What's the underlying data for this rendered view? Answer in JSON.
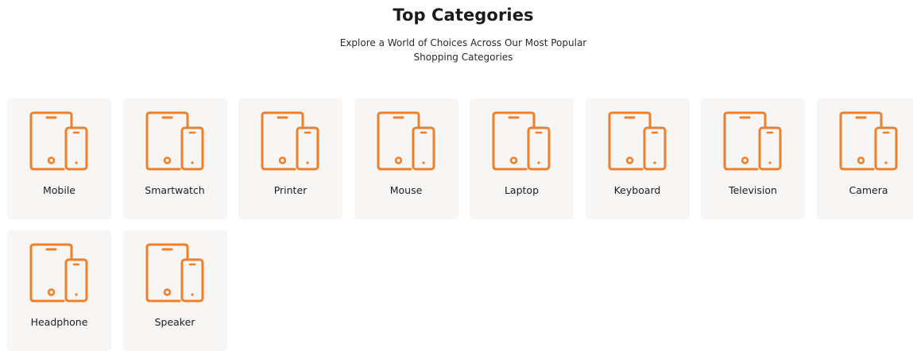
{
  "header": {
    "title": "Top Categories",
    "subtitle": "Explore a World of Choices Across Our Most Popular Shopping Categories"
  },
  "icon": {
    "name": "devices-icon",
    "color": "#f07f2a"
  },
  "categories": [
    {
      "label": "Mobile"
    },
    {
      "label": "Smartwatch"
    },
    {
      "label": "Printer"
    },
    {
      "label": "Mouse"
    },
    {
      "label": "Laptop"
    },
    {
      "label": "Keyboard"
    },
    {
      "label": "Television"
    },
    {
      "label": "Camera"
    },
    {
      "label": "Headphone"
    },
    {
      "label": "Speaker"
    }
  ]
}
